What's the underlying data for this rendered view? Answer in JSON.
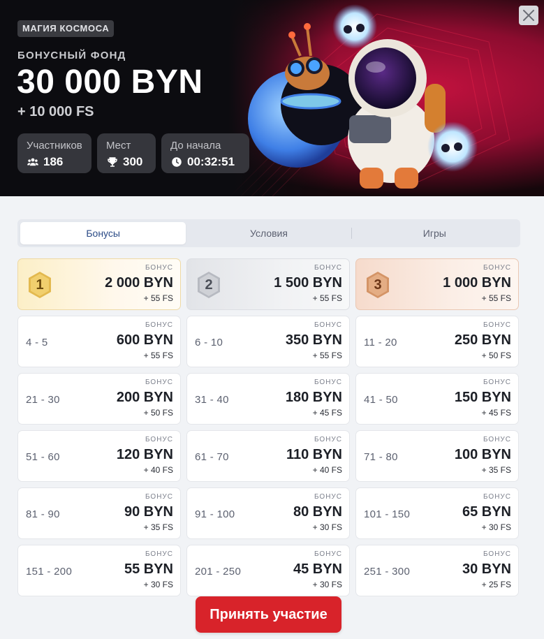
{
  "hero": {
    "tag": "МАГИЯ КОСМОСА",
    "fund_label": "БОНУСНЫЙ ФОНД",
    "fund_amount": "30 000 BYN",
    "fund_extra": "+ 10 000 FS",
    "stats": [
      {
        "label": "Участников",
        "value": "186",
        "icon": "users-icon"
      },
      {
        "label": "Мест",
        "value": "300",
        "icon": "trophy-icon"
      },
      {
        "label": "До начала",
        "value": "00:32:51",
        "icon": "clock-icon"
      }
    ],
    "close_icon": "close-icon"
  },
  "tabs": [
    {
      "label": "Бонусы",
      "active": true
    },
    {
      "label": "Условия",
      "active": false
    },
    {
      "label": "Игры",
      "active": false
    }
  ],
  "prizes": [
    {
      "place": "1",
      "medal": "gold",
      "label": "БОНУС",
      "amount": "2 000 BYN",
      "fs": "+ 55 FS"
    },
    {
      "place": "2",
      "medal": "silver",
      "label": "БОНУС",
      "amount": "1 500 BYN",
      "fs": "+ 55 FS"
    },
    {
      "place": "3",
      "medal": "bronze",
      "label": "БОНУС",
      "amount": "1 000 BYN",
      "fs": "+ 55 FS"
    },
    {
      "place": "4 - 5",
      "label": "БОНУС",
      "amount": "600 BYN",
      "fs": "+ 55 FS"
    },
    {
      "place": "6 - 10",
      "label": "БОНУС",
      "amount": "350 BYN",
      "fs": "+ 55 FS"
    },
    {
      "place": "11 - 20",
      "label": "БОНУС",
      "amount": "250 BYN",
      "fs": "+ 50 FS"
    },
    {
      "place": "21 - 30",
      "label": "БОНУС",
      "amount": "200 BYN",
      "fs": "+ 50 FS"
    },
    {
      "place": "31 - 40",
      "label": "БОНУС",
      "amount": "180 BYN",
      "fs": "+ 45 FS"
    },
    {
      "place": "41 - 50",
      "label": "БОНУС",
      "amount": "150 BYN",
      "fs": "+ 45 FS"
    },
    {
      "place": "51 - 60",
      "label": "БОНУС",
      "amount": "120 BYN",
      "fs": "+ 40 FS"
    },
    {
      "place": "61 - 70",
      "label": "БОНУС",
      "amount": "110 BYN",
      "fs": "+ 40 FS"
    },
    {
      "place": "71 - 80",
      "label": "БОНУС",
      "amount": "100 BYN",
      "fs": "+ 35 FS"
    },
    {
      "place": "81 - 90",
      "label": "БОНУС",
      "amount": "90 BYN",
      "fs": "+ 35 FS"
    },
    {
      "place": "91 - 100",
      "label": "БОНУС",
      "amount": "80 BYN",
      "fs": "+ 30 FS"
    },
    {
      "place": "101 - 150",
      "label": "БОНУС",
      "amount": "65 BYN",
      "fs": "+ 30 FS"
    },
    {
      "place": "151 - 200",
      "label": "БОНУС",
      "amount": "55 BYN",
      "fs": "+ 30 FS"
    },
    {
      "place": "201 - 250",
      "label": "БОНУС",
      "amount": "45 BYN",
      "fs": "+ 30 FS"
    },
    {
      "place": "251 - 300",
      "label": "БОНУС",
      "amount": "30 BYN",
      "fs": "+ 25 FS"
    }
  ],
  "join_button": "Принять участие",
  "colors": {
    "accent": "#d8232a",
    "active_tab_text": "#2a4a86",
    "gold": "#e3b94f",
    "silver": "#b7bac1",
    "bronze": "#d49466"
  }
}
